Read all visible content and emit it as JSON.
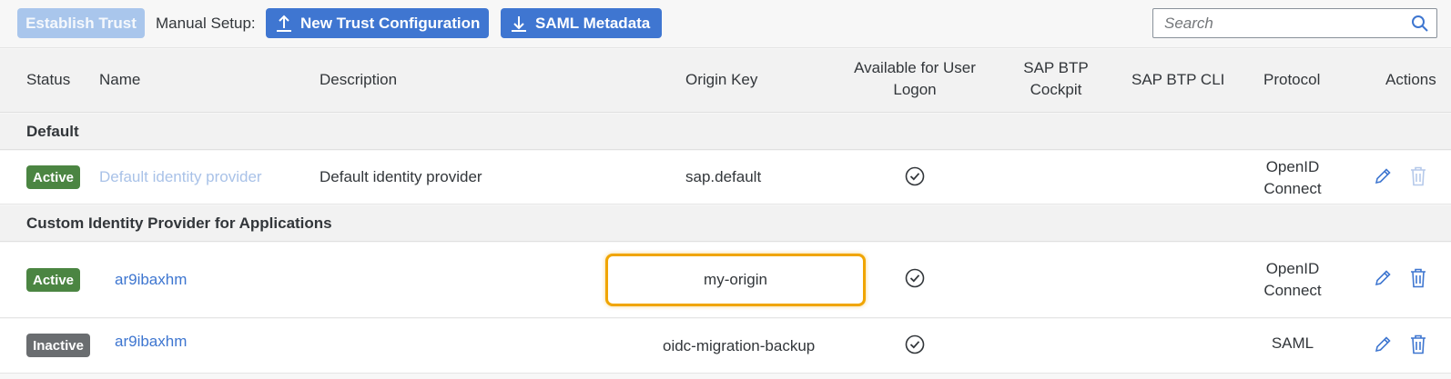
{
  "toolbar": {
    "establish_trust": "Establish Trust",
    "manual_setup": "Manual Setup:",
    "new_trust": "New Trust Configuration",
    "saml_metadata": "SAML Metadata",
    "search_placeholder": "Search"
  },
  "columns": {
    "status": "Status",
    "name": "Name",
    "description": "Description",
    "origin_key": "Origin Key",
    "available_line1": "Available for User",
    "available_line2": "Logon",
    "cockpit_line1": "SAP BTP",
    "cockpit_line2": "Cockpit",
    "cli": "SAP BTP CLI",
    "protocol": "Protocol",
    "actions": "Actions"
  },
  "groups": {
    "default": "Default",
    "custom": "Custom Identity Provider for Applications"
  },
  "rows": [
    {
      "status": "Active",
      "name": "Default identity provider",
      "description": "Default identity provider",
      "origin_key": "sap.default",
      "available": true,
      "protocol_line1": "OpenID",
      "protocol_line2": "Connect"
    },
    {
      "status": "Active",
      "name": "ar9ibaxhm",
      "description": "",
      "origin_key": "my-origin",
      "available": true,
      "protocol_line1": "OpenID",
      "protocol_line2": "Connect"
    },
    {
      "status": "Inactive",
      "name": "ar9ibaxhm",
      "description": "",
      "origin_key": "oidc-migration-backup",
      "available": true,
      "protocol_line1": "SAML",
      "protocol_line2": ""
    }
  ],
  "colors": {
    "accent": "#3f76d1",
    "active_badge": "#4b8542",
    "inactive_badge": "#6a6d70",
    "highlight": "#f0a500"
  }
}
